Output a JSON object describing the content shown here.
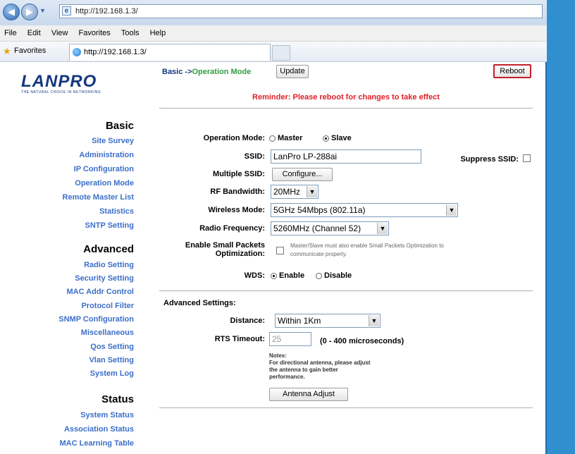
{
  "browser": {
    "url": "http://192.168.1.3/",
    "menu": [
      "File",
      "Edit",
      "View",
      "Favorites",
      "Tools",
      "Help"
    ],
    "favorites_label": "Favorites",
    "tab_title": "http://192.168.1.3/"
  },
  "sidebar": {
    "logo": "LANPRO",
    "logo_tagline": "THE NATURAL CHOICE IN NETWORKING",
    "sections": [
      {
        "title": "Basic",
        "items": [
          "Site Survey",
          "Administration",
          "IP Configuration",
          "Operation Mode",
          "Remote Master List",
          "Statistics",
          "SNTP Setting"
        ]
      },
      {
        "title": "Advanced",
        "items": [
          "Radio Setting",
          "Security Setting",
          "MAC Addr Control",
          "Protocol Filter",
          "SNMP Configuration",
          "Miscellaneous",
          "Qos Setting",
          "Vlan Setting",
          "System Log"
        ]
      },
      {
        "title": "Status",
        "items": [
          "System Status",
          "Association Status",
          "MAC Learning Table"
        ]
      }
    ]
  },
  "main": {
    "breadcrumb_basic": "Basic ->",
    "breadcrumb_page": "Operation Mode",
    "update_label": "Update",
    "reboot_label": "Reboot",
    "reminder": "Reminder: Please reboot for changes to take effect",
    "operation_mode_label": "Operation Mode:",
    "operation_mode_options": [
      "Master",
      "Slave"
    ],
    "operation_mode_selected": "Slave",
    "ssid_label": "SSID:",
    "ssid_value": "LanPro LP-288ai",
    "suppress_ssid_label": "Suppress SSID:",
    "multiple_ssid_label": "Multiple SSID:",
    "configure_label": "Configure...",
    "rf_bandwidth_label": "RF Bandwidth:",
    "rf_bandwidth_value": "20MHz",
    "wireless_mode_label": "Wireless Mode:",
    "wireless_mode_value": "5GHz 54Mbps (802.11a)",
    "radio_frequency_label": "Radio Frequency:",
    "radio_frequency_value": "5260MHz (Channel 52)",
    "small_packets_label_1": "Enable Small Packets",
    "small_packets_label_2": "Optimization:",
    "small_packets_note_1": "Master/Slave must also enable Small Packets Optimization to",
    "small_packets_note_2": "communicate properly.",
    "wds_label": "WDS:",
    "wds_options": [
      "Enable",
      "Disable"
    ],
    "wds_selected": "Enable",
    "advanced_settings_label": "Advanced Settings:",
    "distance_label": "Distance:",
    "distance_value": "Within 1Km",
    "rts_timeout_label": "RTS Timeout:",
    "rts_timeout_value": "25",
    "rts_timeout_range": "(0 - 400 microseconds)",
    "notes_1": "Notes:",
    "notes_2": "For directional antenna, please adjust",
    "notes_3": "the antenna to gain better",
    "notes_4": "performance.",
    "antenna_adjust_label": "Antenna Adjust"
  }
}
